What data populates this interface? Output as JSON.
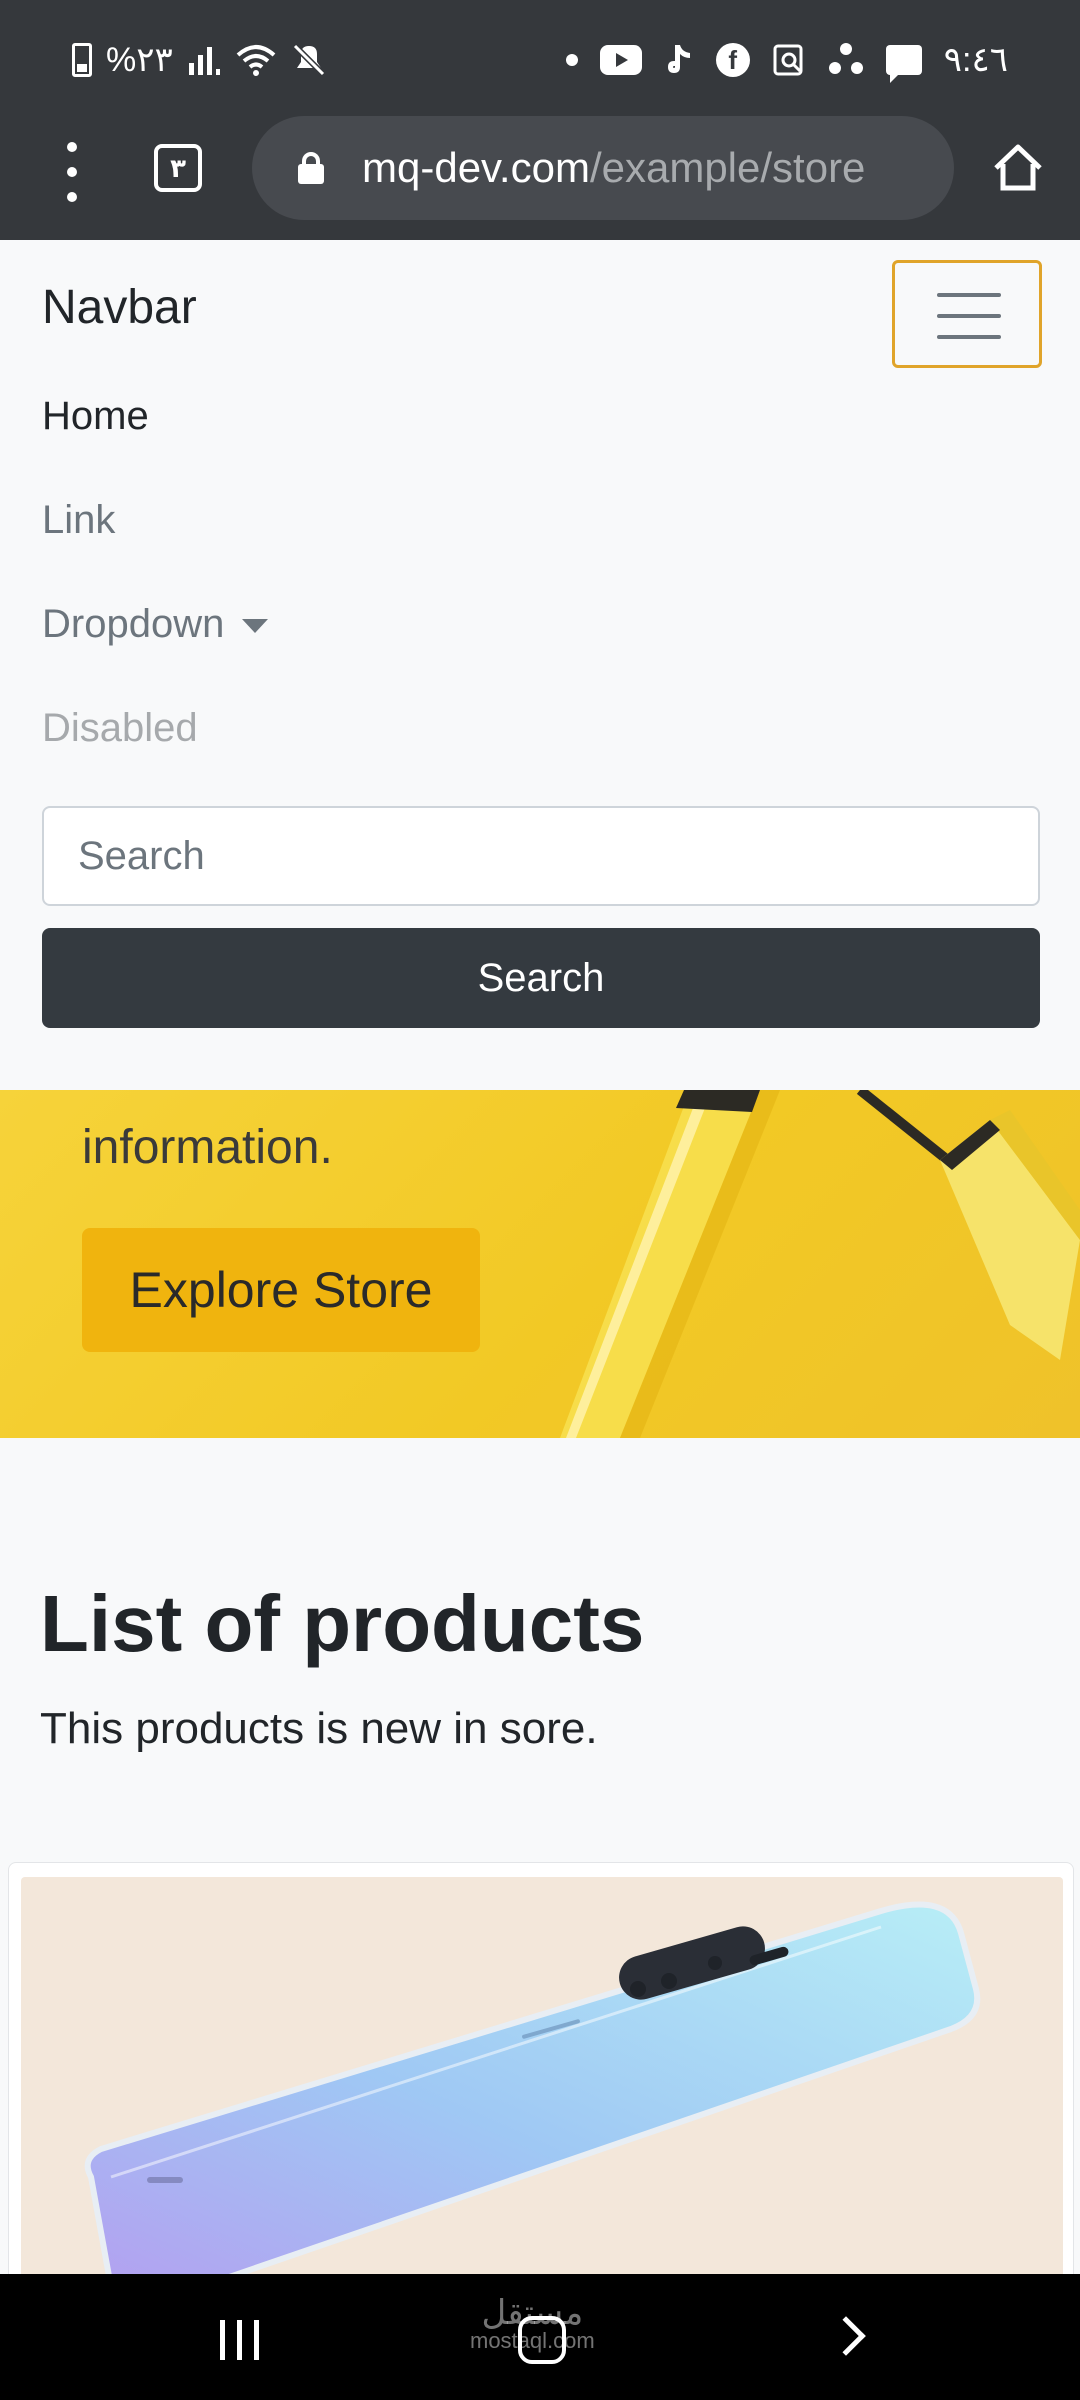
{
  "status_bar": {
    "time": "٩:٤٦",
    "battery": "%٢٣",
    "icons_left": [
      "battery-icon",
      "signal-icon",
      "wifi-icon",
      "mute-icon"
    ],
    "icons_right": [
      "dot-icon",
      "youtube-icon",
      "tiktok-icon",
      "facebook-icon",
      "search-app-icon",
      "hangouts-icon",
      "message-icon"
    ]
  },
  "browser": {
    "tab_count": "٣",
    "url_host": "mq-dev.com",
    "url_path": "/example/store"
  },
  "navbar": {
    "brand": "Navbar",
    "items": [
      {
        "label": "Home"
      },
      {
        "label": "Link"
      },
      {
        "label": "Dropdown"
      },
      {
        "label": "Disabled"
      }
    ],
    "search_placeholder": "Search",
    "search_button": "Search",
    "toggler_border_color": "#e0a42a"
  },
  "hero": {
    "text": "information.",
    "button": "Explore Store"
  },
  "products": {
    "title": "List of products",
    "subtitle": "This products is new in sore."
  },
  "watermark": {
    "arabic": "مستقل",
    "latin": "mostaql.com"
  }
}
